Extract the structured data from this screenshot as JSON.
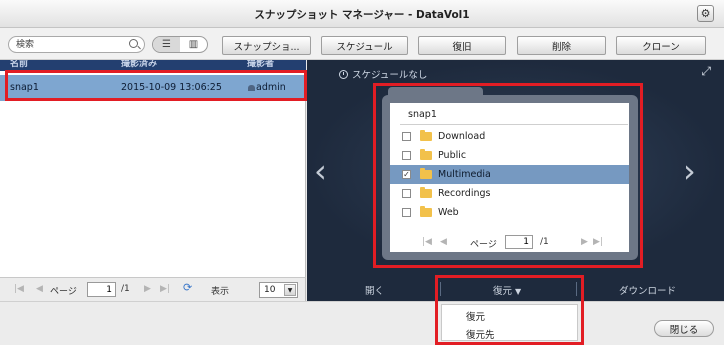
{
  "window": {
    "title": "スナップショット マネージャー - DataVol1"
  },
  "toolbar": {
    "search_placeholder": "検索",
    "snapshot_label": "スナップショ...",
    "schedule_label": "スケジュール",
    "revert_label": "復旧",
    "delete_label": "削除",
    "clone_label": "クローン"
  },
  "list": {
    "headers": [
      "名前",
      "撮影済み",
      "撮影者"
    ],
    "rows": [
      {
        "name": "snap1",
        "taken": "2015-10-09 13:06:25",
        "by": "admin",
        "selected": true
      }
    ]
  },
  "pager": {
    "page_label": "ページ",
    "page_value": "1",
    "total": "/1",
    "show_label": "表示",
    "per_page": "10"
  },
  "preview": {
    "schedule_text": "スケジュールなし",
    "snapshot_name": "snap1",
    "folders": [
      {
        "name": "Download",
        "checked": false,
        "selected": false
      },
      {
        "name": "Public",
        "checked": false,
        "selected": false
      },
      {
        "name": "Multimedia",
        "checked": true,
        "selected": true
      },
      {
        "name": "Recordings",
        "checked": false,
        "selected": false
      },
      {
        "name": "Web",
        "checked": false,
        "selected": false
      }
    ],
    "page_label": "ページ",
    "page_value": "1",
    "page_total": "/1"
  },
  "actions": {
    "open_label": "開く",
    "restore_label": "復元",
    "download_label": "ダウンロード"
  },
  "restore_menu": {
    "items": [
      "復元",
      "復元先"
    ]
  },
  "footer": {
    "close_label": "閉じる"
  },
  "colors": {
    "highlight": "#e21d24",
    "selected_row": "#7ea6d0",
    "preview_bg": "#1e2a3d"
  }
}
